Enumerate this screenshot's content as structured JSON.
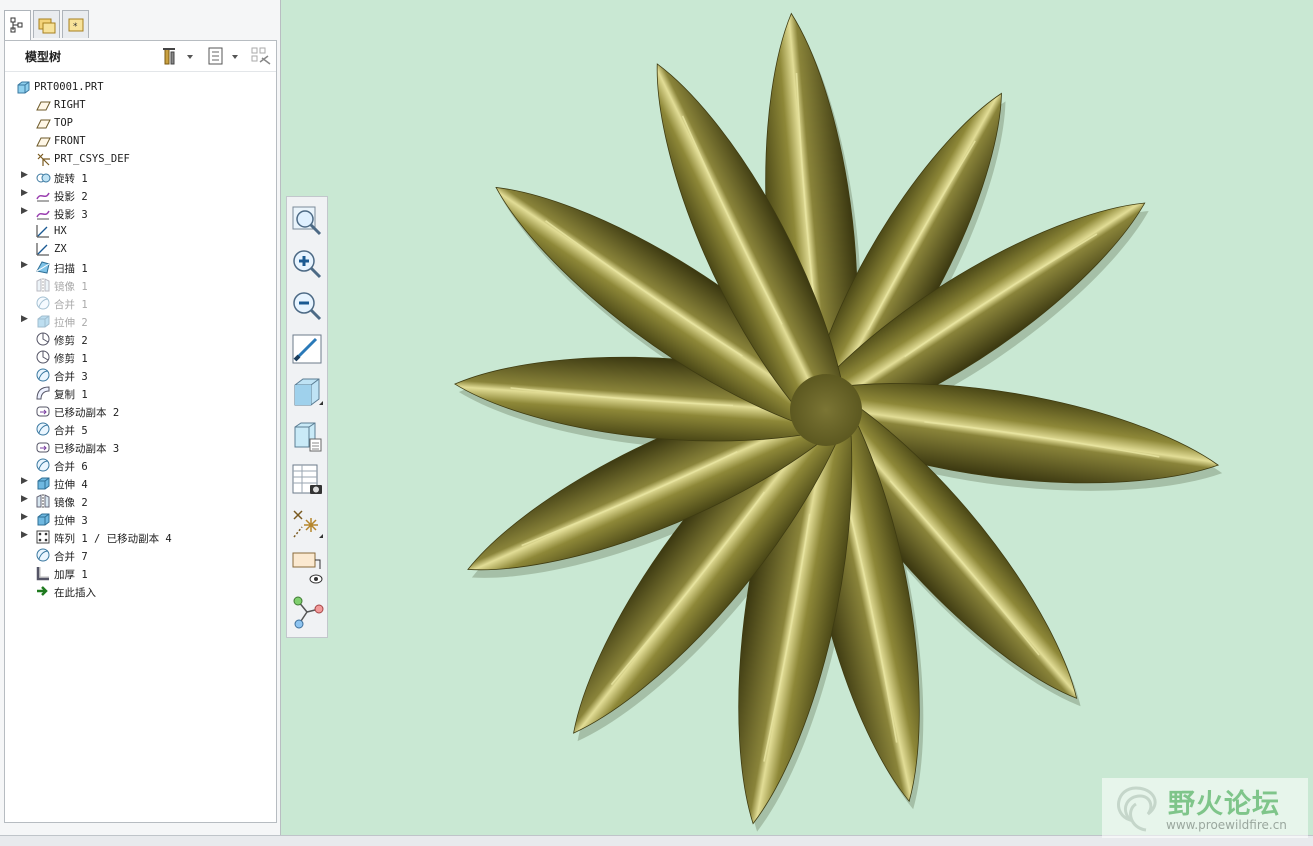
{
  "panel": {
    "title": "模型树",
    "tabs": [
      {
        "icon": "model-tree-icon"
      },
      {
        "icon": "folder-browser-icon"
      },
      {
        "icon": "favorites-icon"
      }
    ]
  },
  "tree": [
    {
      "label": "PRT0001.PRT",
      "icon": "part-icon",
      "expandable": false,
      "dim": false,
      "level": 0
    },
    {
      "label": "RIGHT",
      "icon": "datum-plane-icon",
      "expandable": false,
      "dim": false,
      "level": 1
    },
    {
      "label": "TOP",
      "icon": "datum-plane-icon",
      "expandable": false,
      "dim": false,
      "level": 1
    },
    {
      "label": "FRONT",
      "icon": "datum-plane-icon",
      "expandable": false,
      "dim": false,
      "level": 1
    },
    {
      "label": "PRT_CSYS_DEF",
      "icon": "coordinate-system-icon",
      "expandable": false,
      "dim": false,
      "level": 1
    },
    {
      "label": "旋转 1",
      "icon": "revolve-icon",
      "expandable": true,
      "dim": false,
      "level": 1
    },
    {
      "label": "投影 2",
      "icon": "project-curve-icon",
      "expandable": true,
      "dim": false,
      "level": 1
    },
    {
      "label": "投影 3",
      "icon": "project-curve-icon",
      "expandable": true,
      "dim": false,
      "level": 1
    },
    {
      "label": "HX",
      "icon": "sketch-icon",
      "expandable": false,
      "dim": false,
      "level": 1
    },
    {
      "label": "ZX",
      "icon": "sketch-icon",
      "expandable": false,
      "dim": false,
      "level": 1
    },
    {
      "label": "扫描 1",
      "icon": "sweep-icon",
      "expandable": true,
      "dim": false,
      "level": 1
    },
    {
      "label": "镜像 1",
      "icon": "mirror-icon",
      "expandable": false,
      "dim": true,
      "level": 1
    },
    {
      "label": "合并 1",
      "icon": "merge-icon",
      "expandable": false,
      "dim": true,
      "level": 1
    },
    {
      "label": "拉伸 2",
      "icon": "extrude-icon",
      "expandable": true,
      "dim": true,
      "level": 1
    },
    {
      "label": "修剪 2",
      "icon": "trim-icon",
      "expandable": false,
      "dim": false,
      "level": 1
    },
    {
      "label": "修剪 1",
      "icon": "trim-icon",
      "expandable": false,
      "dim": false,
      "level": 1
    },
    {
      "label": "合并 3",
      "icon": "merge-icon",
      "expandable": false,
      "dim": false,
      "level": 1
    },
    {
      "label": "复制 1",
      "icon": "copy-icon",
      "expandable": false,
      "dim": false,
      "level": 1
    },
    {
      "label": "已移动副本 2",
      "icon": "moved-copy-icon",
      "expandable": false,
      "dim": false,
      "level": 1
    },
    {
      "label": "合并 5",
      "icon": "merge-icon",
      "expandable": false,
      "dim": false,
      "level": 1
    },
    {
      "label": "已移动副本 3",
      "icon": "moved-copy-icon",
      "expandable": false,
      "dim": false,
      "level": 1
    },
    {
      "label": "合并 6",
      "icon": "merge-icon",
      "expandable": false,
      "dim": false,
      "level": 1
    },
    {
      "label": "拉伸 4",
      "icon": "extrude-icon",
      "expandable": true,
      "dim": false,
      "level": 1
    },
    {
      "label": "镜像 2",
      "icon": "mirror-icon",
      "expandable": true,
      "dim": false,
      "level": 1
    },
    {
      "label": "拉伸 3",
      "icon": "extrude-icon",
      "expandable": true,
      "dim": false,
      "level": 1
    },
    {
      "label": "阵列 1 / 已移动副本 4",
      "icon": "pattern-icon",
      "expandable": true,
      "dim": false,
      "level": 1
    },
    {
      "label": "合并 7",
      "icon": "merge-icon",
      "expandable": false,
      "dim": false,
      "level": 1
    },
    {
      "label": "加厚 1",
      "icon": "thicken-icon",
      "expandable": false,
      "dim": false,
      "level": 1
    },
    {
      "label": "在此插入",
      "icon": "insert-here-arrow-icon",
      "expandable": false,
      "dim": false,
      "level": 1
    }
  ],
  "toolbar": [
    {
      "name": "refit-button",
      "icon": "zoom-refit-icon"
    },
    {
      "name": "zoom-in-button",
      "icon": "zoom-in-icon"
    },
    {
      "name": "zoom-out-button",
      "icon": "zoom-out-icon"
    },
    {
      "name": "repaint-button",
      "icon": "repaint-icon"
    },
    {
      "name": "display-style-button",
      "icon": "shaded-cube-icon"
    },
    {
      "name": "saved-orientations-button",
      "icon": "saved-views-icon"
    },
    {
      "name": "view-manager-button",
      "icon": "view-manager-icon"
    },
    {
      "name": "datum-display-button",
      "icon": "datum-display-icon"
    },
    {
      "name": "annotation-display-button",
      "icon": "annotation-eye-icon"
    },
    {
      "name": "spin-center-button",
      "icon": "spin-center-icon"
    }
  ],
  "colors": {
    "viewport_bg": "#c9e8d3",
    "model_olive": "#7a7430",
    "model_highlight": "#e8e4a0",
    "model_shadow": "#3f3c12"
  },
  "watermark": {
    "text": "野火论坛",
    "url": "www.proewildfire.cn"
  }
}
